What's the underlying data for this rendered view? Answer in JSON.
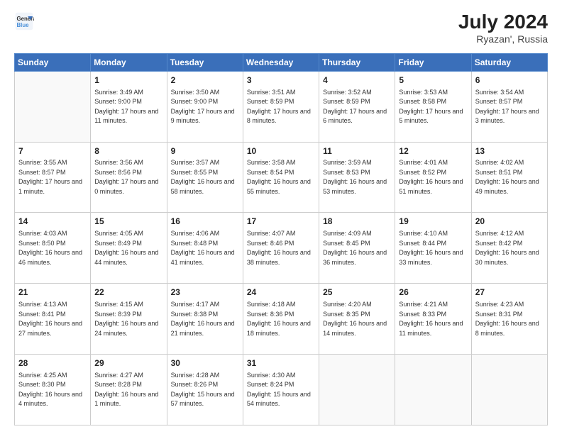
{
  "header": {
    "logo_line1": "General",
    "logo_line2": "Blue",
    "month_year": "July 2024",
    "location": "Ryazan', Russia"
  },
  "weekdays": [
    "Sunday",
    "Monday",
    "Tuesday",
    "Wednesday",
    "Thursday",
    "Friday",
    "Saturday"
  ],
  "days": [
    {
      "num": "",
      "sunrise": "",
      "sunset": "",
      "daylight": ""
    },
    {
      "num": "1",
      "sunrise": "Sunrise: 3:49 AM",
      "sunset": "Sunset: 9:00 PM",
      "daylight": "Daylight: 17 hours and 11 minutes."
    },
    {
      "num": "2",
      "sunrise": "Sunrise: 3:50 AM",
      "sunset": "Sunset: 9:00 PM",
      "daylight": "Daylight: 17 hours and 9 minutes."
    },
    {
      "num": "3",
      "sunrise": "Sunrise: 3:51 AM",
      "sunset": "Sunset: 8:59 PM",
      "daylight": "Daylight: 17 hours and 8 minutes."
    },
    {
      "num": "4",
      "sunrise": "Sunrise: 3:52 AM",
      "sunset": "Sunset: 8:59 PM",
      "daylight": "Daylight: 17 hours and 6 minutes."
    },
    {
      "num": "5",
      "sunrise": "Sunrise: 3:53 AM",
      "sunset": "Sunset: 8:58 PM",
      "daylight": "Daylight: 17 hours and 5 minutes."
    },
    {
      "num": "6",
      "sunrise": "Sunrise: 3:54 AM",
      "sunset": "Sunset: 8:57 PM",
      "daylight": "Daylight: 17 hours and 3 minutes."
    },
    {
      "num": "7",
      "sunrise": "Sunrise: 3:55 AM",
      "sunset": "Sunset: 8:57 PM",
      "daylight": "Daylight: 17 hours and 1 minute."
    },
    {
      "num": "8",
      "sunrise": "Sunrise: 3:56 AM",
      "sunset": "Sunset: 8:56 PM",
      "daylight": "Daylight: 17 hours and 0 minutes."
    },
    {
      "num": "9",
      "sunrise": "Sunrise: 3:57 AM",
      "sunset": "Sunset: 8:55 PM",
      "daylight": "Daylight: 16 hours and 58 minutes."
    },
    {
      "num": "10",
      "sunrise": "Sunrise: 3:58 AM",
      "sunset": "Sunset: 8:54 PM",
      "daylight": "Daylight: 16 hours and 55 minutes."
    },
    {
      "num": "11",
      "sunrise": "Sunrise: 3:59 AM",
      "sunset": "Sunset: 8:53 PM",
      "daylight": "Daylight: 16 hours and 53 minutes."
    },
    {
      "num": "12",
      "sunrise": "Sunrise: 4:01 AM",
      "sunset": "Sunset: 8:52 PM",
      "daylight": "Daylight: 16 hours and 51 minutes."
    },
    {
      "num": "13",
      "sunrise": "Sunrise: 4:02 AM",
      "sunset": "Sunset: 8:51 PM",
      "daylight": "Daylight: 16 hours and 49 minutes."
    },
    {
      "num": "14",
      "sunrise": "Sunrise: 4:03 AM",
      "sunset": "Sunset: 8:50 PM",
      "daylight": "Daylight: 16 hours and 46 minutes."
    },
    {
      "num": "15",
      "sunrise": "Sunrise: 4:05 AM",
      "sunset": "Sunset: 8:49 PM",
      "daylight": "Daylight: 16 hours and 44 minutes."
    },
    {
      "num": "16",
      "sunrise": "Sunrise: 4:06 AM",
      "sunset": "Sunset: 8:48 PM",
      "daylight": "Daylight: 16 hours and 41 minutes."
    },
    {
      "num": "17",
      "sunrise": "Sunrise: 4:07 AM",
      "sunset": "Sunset: 8:46 PM",
      "daylight": "Daylight: 16 hours and 38 minutes."
    },
    {
      "num": "18",
      "sunrise": "Sunrise: 4:09 AM",
      "sunset": "Sunset: 8:45 PM",
      "daylight": "Daylight: 16 hours and 36 minutes."
    },
    {
      "num": "19",
      "sunrise": "Sunrise: 4:10 AM",
      "sunset": "Sunset: 8:44 PM",
      "daylight": "Daylight: 16 hours and 33 minutes."
    },
    {
      "num": "20",
      "sunrise": "Sunrise: 4:12 AM",
      "sunset": "Sunset: 8:42 PM",
      "daylight": "Daylight: 16 hours and 30 minutes."
    },
    {
      "num": "21",
      "sunrise": "Sunrise: 4:13 AM",
      "sunset": "Sunset: 8:41 PM",
      "daylight": "Daylight: 16 hours and 27 minutes."
    },
    {
      "num": "22",
      "sunrise": "Sunrise: 4:15 AM",
      "sunset": "Sunset: 8:39 PM",
      "daylight": "Daylight: 16 hours and 24 minutes."
    },
    {
      "num": "23",
      "sunrise": "Sunrise: 4:17 AM",
      "sunset": "Sunset: 8:38 PM",
      "daylight": "Daylight: 16 hours and 21 minutes."
    },
    {
      "num": "24",
      "sunrise": "Sunrise: 4:18 AM",
      "sunset": "Sunset: 8:36 PM",
      "daylight": "Daylight: 16 hours and 18 minutes."
    },
    {
      "num": "25",
      "sunrise": "Sunrise: 4:20 AM",
      "sunset": "Sunset: 8:35 PM",
      "daylight": "Daylight: 16 hours and 14 minutes."
    },
    {
      "num": "26",
      "sunrise": "Sunrise: 4:21 AM",
      "sunset": "Sunset: 8:33 PM",
      "daylight": "Daylight: 16 hours and 11 minutes."
    },
    {
      "num": "27",
      "sunrise": "Sunrise: 4:23 AM",
      "sunset": "Sunset: 8:31 PM",
      "daylight": "Daylight: 16 hours and 8 minutes."
    },
    {
      "num": "28",
      "sunrise": "Sunrise: 4:25 AM",
      "sunset": "Sunset: 8:30 PM",
      "daylight": "Daylight: 16 hours and 4 minutes."
    },
    {
      "num": "29",
      "sunrise": "Sunrise: 4:27 AM",
      "sunset": "Sunset: 8:28 PM",
      "daylight": "Daylight: 16 hours and 1 minute."
    },
    {
      "num": "30",
      "sunrise": "Sunrise: 4:28 AM",
      "sunset": "Sunset: 8:26 PM",
      "daylight": "Daylight: 15 hours and 57 minutes."
    },
    {
      "num": "31",
      "sunrise": "Sunrise: 4:30 AM",
      "sunset": "Sunset: 8:24 PM",
      "daylight": "Daylight: 15 hours and 54 minutes."
    },
    {
      "num": "",
      "sunrise": "",
      "sunset": "",
      "daylight": ""
    },
    {
      "num": "",
      "sunrise": "",
      "sunset": "",
      "daylight": ""
    },
    {
      "num": "",
      "sunrise": "",
      "sunset": "",
      "daylight": ""
    }
  ]
}
